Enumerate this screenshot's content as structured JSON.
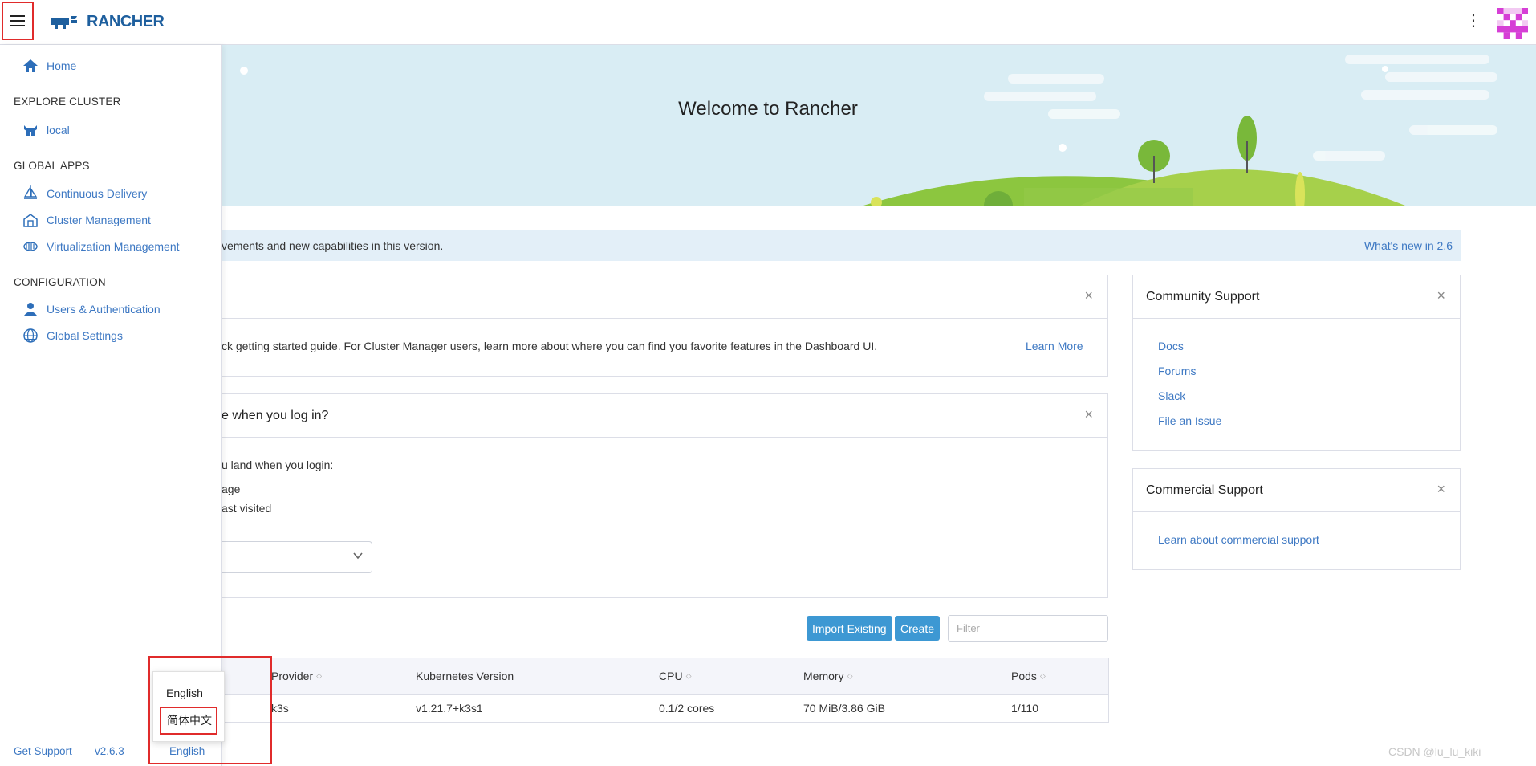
{
  "header": {
    "logo_text": "RANCHER",
    "brand_color": "#1e5f9e"
  },
  "banner": {
    "title": "Welcome to Rancher"
  },
  "sidebar": {
    "home": "Home",
    "sections": [
      {
        "title": "EXPLORE CLUSTER",
        "items": [
          "local"
        ]
      },
      {
        "title": "GLOBAL APPS",
        "items": [
          "Continuous Delivery",
          "Cluster Management",
          "Virtualization Management"
        ]
      },
      {
        "title": "CONFIGURATION",
        "items": [
          "Users & Authentication",
          "Global Settings"
        ]
      }
    ],
    "footer": {
      "support": "Get Support",
      "version": "v2.6.3",
      "language": "English"
    },
    "language_menu": [
      "English",
      "简体中文"
    ]
  },
  "notice": {
    "text": "vements and new capabilities in this version.",
    "link": "What's new in 2.6"
  },
  "getting_started": {
    "text": "ck getting started guide. For Cluster Manager users, learn more about where you can find you favorite features in the Dashboard UI.",
    "link": "Learn More"
  },
  "landing": {
    "title": "e when you log in?",
    "prompt": "u land when you login:",
    "option1": "age",
    "option2": "ast visited"
  },
  "community": {
    "title": "Community Support",
    "links": [
      "Docs",
      "Forums",
      "Slack",
      "File an Issue"
    ]
  },
  "commercial": {
    "title": "Commercial Support",
    "link": "Learn about commercial support"
  },
  "clusters": {
    "import_label": "Import Existing",
    "create_label": "Create",
    "filter_placeholder": "Filter",
    "columns": [
      "Provider",
      "Kubernetes Version",
      "CPU",
      "Memory",
      "Pods"
    ],
    "rows": [
      {
        "provider": "k3s",
        "version": "v1.21.7+k3s1",
        "cpu": "0.1/2 cores",
        "memory": "70 MiB/3.86 GiB",
        "pods": "1/110"
      }
    ]
  },
  "watermark": "CSDN @lu_lu_kiki"
}
